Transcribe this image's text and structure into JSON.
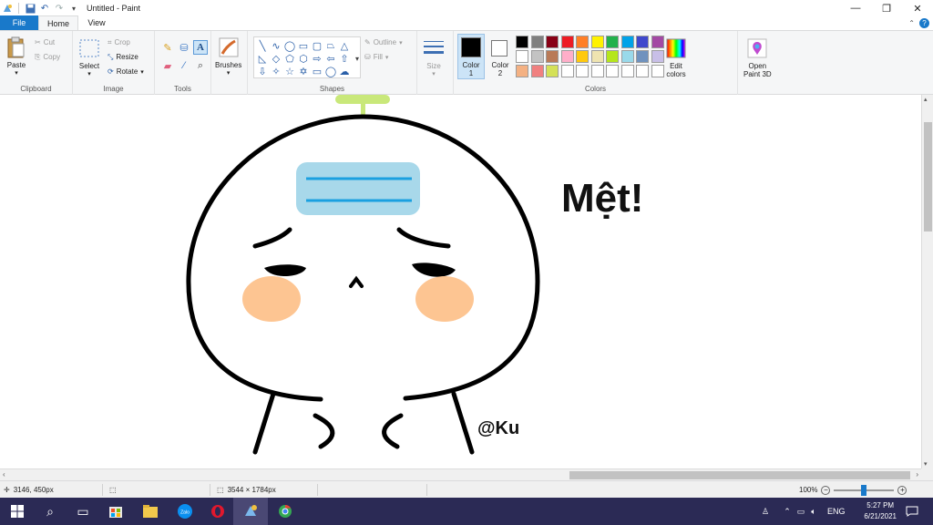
{
  "window": {
    "title": "Untitled - Paint",
    "controls": {
      "minimize": "—",
      "restore": "❐",
      "close": "✕"
    }
  },
  "tabs": [
    {
      "label": "File"
    },
    {
      "label": "Home"
    },
    {
      "label": "View"
    }
  ],
  "ribbon": {
    "clipboard": {
      "label": "Clipboard",
      "paste": "Paste",
      "cut": "Cut",
      "copy": "Copy"
    },
    "image": {
      "label": "Image",
      "select": "Select",
      "crop": "Crop",
      "resize": "Resize",
      "rotate": "Rotate"
    },
    "tools": {
      "label": "Tools"
    },
    "brushes": {
      "label": "Brushes"
    },
    "shapes": {
      "label": "Shapes",
      "outline": "Outline",
      "fill": "Fill"
    },
    "size": {
      "label": "Size"
    },
    "colors": {
      "label": "Colors",
      "color1": "Color\n1",
      "color1_label": "Color",
      "color1_num": "1",
      "color2_label": "Color",
      "color2_num": "2",
      "edit_colors_1": "Edit",
      "edit_colors_2": "colors",
      "palette_row1": [
        "#000000",
        "#7f7f7f",
        "#880015",
        "#ed1c24",
        "#ff7f27",
        "#fff200",
        "#22b14c",
        "#00a2e8",
        "#3f48cc",
        "#a349a4"
      ],
      "palette_row2": [
        "#ffffff",
        "#c3c3c3",
        "#b97a57",
        "#ffaec9",
        "#ffc90e",
        "#efe4b0",
        "#b5e61d",
        "#99d9ea",
        "#7092be",
        "#c8bfe7"
      ],
      "palette_row3": [
        "#f4b183",
        "#f08080",
        "#d4e157",
        "#ffffff",
        "#ffffff",
        "#ffffff",
        "#ffffff",
        "#ffffff",
        "#ffffff",
        "#ffffff"
      ],
      "color1_value": "#000000",
      "color2_value": "#ffffff"
    },
    "paint3d": {
      "label_1": "Open",
      "label_2": "Paint 3D"
    }
  },
  "canvas": {
    "caption": "Mệt!",
    "signature": "@Ku"
  },
  "status": {
    "cursor_pos": "3146, 450px",
    "image_size": "3544 × 1784px",
    "zoom": "100%"
  },
  "taskbar": {
    "lang": "ENG",
    "time": "5:27 PM",
    "date": "6/21/2021"
  }
}
